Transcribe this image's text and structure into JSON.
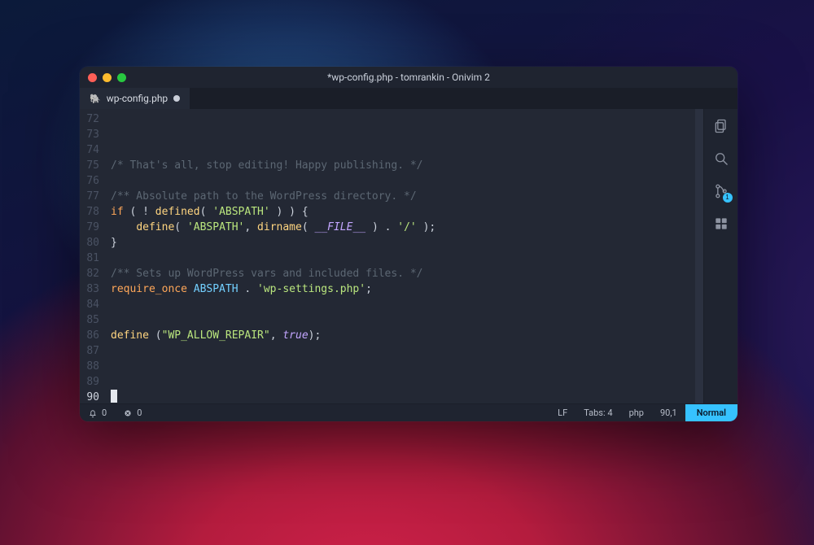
{
  "window_title": "*wp-config.php - tomrankin - Onivim 2",
  "tab": {
    "icon_name": "elephant-icon",
    "label": "wp-config.php",
    "modified": true
  },
  "editor": {
    "first_line": 72,
    "cursor_line": 90,
    "lines": {
      "72": [],
      "73": [],
      "74": [],
      "75": [
        {
          "c": "comment",
          "t": "/* That's all, stop editing! Happy publishing. */"
        }
      ],
      "76": [],
      "77": [
        {
          "c": "comment",
          "t": "/** Absolute path to the WordPress directory. */"
        }
      ],
      "78": [
        {
          "c": "kw",
          "t": "if"
        },
        {
          "c": "pun",
          "t": " ( "
        },
        {
          "c": "pun",
          "t": "! "
        },
        {
          "c": "fn",
          "t": "defined"
        },
        {
          "c": "pun",
          "t": "( "
        },
        {
          "c": "str",
          "t": "'ABSPATH'"
        },
        {
          "c": "pun",
          "t": " ) ) {"
        }
      ],
      "79": [
        {
          "c": "pun",
          "t": "    "
        },
        {
          "c": "fn",
          "t": "define"
        },
        {
          "c": "pun",
          "t": "( "
        },
        {
          "c": "str",
          "t": "'ABSPATH'"
        },
        {
          "c": "pun",
          "t": ", "
        },
        {
          "c": "fn",
          "t": "dirname"
        },
        {
          "c": "pun",
          "t": "( "
        },
        {
          "c": "const",
          "t": "__FILE__"
        },
        {
          "c": "pun",
          "t": " ) . "
        },
        {
          "c": "str",
          "t": "'/'"
        },
        {
          "c": "pun",
          "t": " );"
        }
      ],
      "80": [
        {
          "c": "pun",
          "t": "}"
        }
      ],
      "81": [],
      "82": [
        {
          "c": "comment",
          "t": "/** Sets up WordPress vars and included files. */"
        }
      ],
      "83": [
        {
          "c": "kw",
          "t": "require_once"
        },
        {
          "c": "pun",
          "t": " "
        },
        {
          "c": "ident",
          "t": "ABSPATH"
        },
        {
          "c": "pun",
          "t": " . "
        },
        {
          "c": "str",
          "t": "'wp-settings.php'"
        },
        {
          "c": "pun",
          "t": ";"
        }
      ],
      "84": [],
      "85": [],
      "86": [
        {
          "c": "fn",
          "t": "define"
        },
        {
          "c": "pun",
          "t": " ("
        },
        {
          "c": "str",
          "t": "\"WP_ALLOW_REPAIR\""
        },
        {
          "c": "pun",
          "t": ", "
        },
        {
          "c": "bool",
          "t": "true"
        },
        {
          "c": "pun",
          "t": ");"
        }
      ],
      "87": [],
      "88": [],
      "89": [],
      "90": [
        {
          "c": "cursor",
          "t": ""
        }
      ]
    }
  },
  "sidebar": {
    "items": [
      {
        "name": "files-icon",
        "badge": null
      },
      {
        "name": "search-icon",
        "badge": null
      },
      {
        "name": "source-control-icon",
        "badge": "1"
      },
      {
        "name": "extensions-icon",
        "badge": null
      }
    ]
  },
  "status": {
    "notifications": "0",
    "errors": "0",
    "line_ending": "LF",
    "indentation": "Tabs: 4",
    "language": "php",
    "position": "90,1",
    "mode": "Normal"
  }
}
